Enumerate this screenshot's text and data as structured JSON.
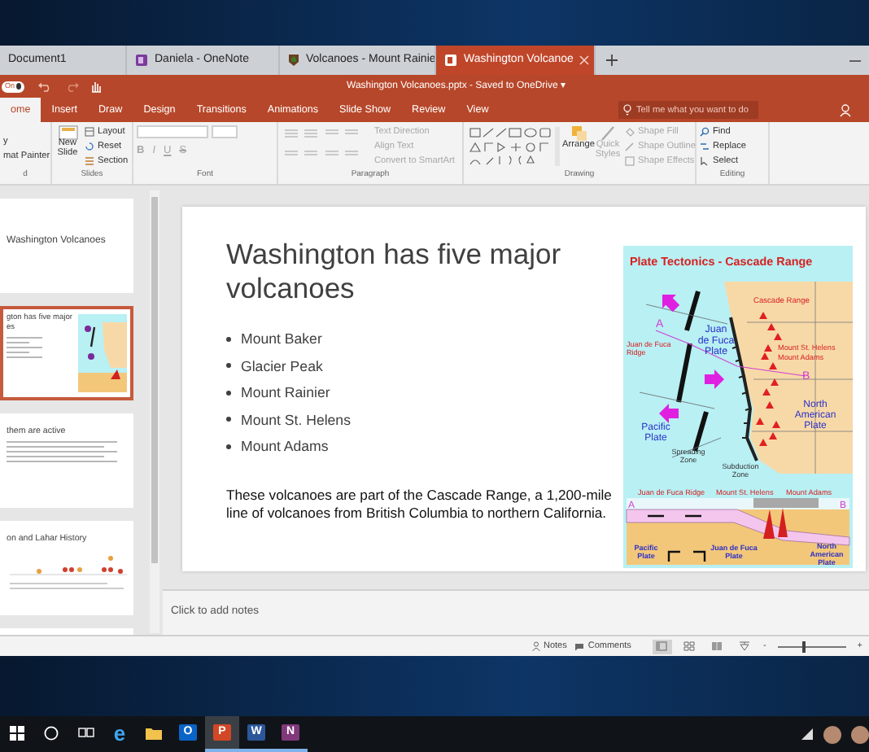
{
  "browser_tabs": [
    {
      "label": "Document1",
      "kind": "plain",
      "selected": false
    },
    {
      "label": "Daniela - OneNote",
      "kind": "notebook",
      "selected": false
    },
    {
      "label": "Volcanoes - Mount Rainie",
      "kind": "shield",
      "selected": false
    },
    {
      "label": "Washington Volcanoe",
      "kind": "slides",
      "selected": true
    }
  ],
  "title_bar": {
    "autosave": "On",
    "autosave_on": true,
    "title": "Washington Volcanoes.pptx - Saved to OneDrive ▾"
  },
  "ribbon_tabs": [
    {
      "label": "ome",
      "selected": true
    },
    {
      "label": "Insert",
      "selected": false
    },
    {
      "label": "Draw",
      "selected": false
    },
    {
      "label": "Design",
      "selected": false
    },
    {
      "label": "Transitions",
      "selected": false
    },
    {
      "label": "Animations",
      "selected": false
    },
    {
      "label": "Slide Show",
      "selected": false
    },
    {
      "label": "Review",
      "selected": false
    },
    {
      "label": "View",
      "selected": false
    }
  ],
  "search": {
    "placeholder": "Tell me what you want to do"
  },
  "ribbon": {
    "clipboard": {
      "commands": [
        "y",
        "mat Painter"
      ],
      "label": "d"
    },
    "slides": {
      "new_slide": "New Slide",
      "commands": [
        "Layout",
        "Reset",
        "Section"
      ],
      "label": "Slides"
    },
    "font": {
      "formatting": [
        {
          "label": "B",
          "disabled": true
        },
        {
          "label": "I",
          "disabled": true
        },
        {
          "label": "U",
          "disabled": true
        },
        {
          "label": "S",
          "disabled": true
        }
      ],
      "label": "Font"
    },
    "paragraph": {
      "commands": [
        {
          "label": "Text Direction",
          "disabled": true
        },
        {
          "label": "Align Text",
          "disabled": true
        },
        {
          "label": "Convert to SmartArt",
          "disabled": true
        }
      ],
      "label": "Paragraph"
    },
    "drawing": {
      "arrange": "Arrange",
      "quick_styles": {
        "label": "Quick Styles",
        "disabled": true
      },
      "commands": [
        {
          "label": "Shape Fill",
          "disabled": true
        },
        {
          "label": "Shape Outline",
          "disabled": true
        },
        {
          "label": "Shape Effects",
          "disabled": true
        }
      ],
      "label": "Drawing"
    },
    "editing": {
      "commands": [
        "Find",
        "Replace",
        "Select"
      ],
      "label": "Editing"
    }
  },
  "thumbnails": [
    {
      "kind": "title",
      "lines": [
        "Washington Volcanoes"
      ],
      "selected": false
    },
    {
      "kind": "map",
      "lines": [
        "gton has five major",
        "es"
      ],
      "selected": true
    },
    {
      "kind": "text",
      "lines": [
        "them are active"
      ],
      "selected": false
    },
    {
      "kind": "chart",
      "lines": [
        "on and Lahar History"
      ],
      "selected": false
    },
    {
      "kind": "blank",
      "selected": false
    }
  ],
  "slide": {
    "title": "Washington has five major volcanoes",
    "bullets": [
      "Mount Baker",
      "Glacier Peak",
      "Mount Rainier",
      "Mount St. Helens",
      "Mount Adams"
    ],
    "paragraph": "These volcanoes are part of the Cascade Range, a 1,200-mile line of volcanoes from British Columbia to northern California.",
    "diagram": {
      "title": "Plate Tectonics - Cascade Range",
      "labels": [
        {
          "kind": "place",
          "lines": [
            "Cascade Range"
          ]
        },
        {
          "kind": "point",
          "lines": [
            "A"
          ]
        },
        {
          "kind": "place",
          "lines": [
            "Juan de Fuca",
            "Ridge"
          ]
        },
        {
          "kind": "plate",
          "lines": [
            "Juan",
            "de Fuca",
            "Plate"
          ]
        },
        {
          "kind": "place",
          "lines": [
            "Mount St. Helens"
          ]
        },
        {
          "kind": "place",
          "lines": [
            "Mount Adams"
          ]
        },
        {
          "kind": "point",
          "lines": [
            "B"
          ]
        },
        {
          "kind": "plate",
          "lines": [
            "North",
            "American",
            "Plate"
          ]
        },
        {
          "kind": "plate",
          "lines": [
            "Pacific",
            "Plate"
          ]
        },
        {
          "kind": "zone",
          "lines": [
            "Spreading",
            "Zone"
          ]
        },
        {
          "kind": "zone",
          "lines": [
            "Subduction",
            "Zone"
          ]
        },
        {
          "kind": "point",
          "lines": [
            "A"
          ]
        },
        {
          "kind": "place",
          "lines": [
            "Juan de Fuca Ridge"
          ]
        },
        {
          "kind": "place",
          "lines": [
            "Mount St. Helens"
          ]
        },
        {
          "kind": "place",
          "lines": [
            "Mount Adams"
          ]
        },
        {
          "kind": "point",
          "lines": [
            "B"
          ]
        },
        {
          "kind": "plate",
          "lines": [
            "Pacific",
            "Plate"
          ]
        },
        {
          "kind": "plate",
          "lines": [
            "Juan de Fuca",
            "Plate"
          ]
        },
        {
          "kind": "plate",
          "lines": [
            "North",
            "American",
            "Plate"
          ]
        }
      ]
    }
  },
  "notes": {
    "placeholder": "Click to add notes"
  },
  "status_bar": {
    "notes": "Notes",
    "comments": "Comments",
    "views": [
      {
        "kind": "normal",
        "selected": true
      },
      {
        "kind": "sorter",
        "selected": false
      },
      {
        "kind": "reading",
        "selected": false
      },
      {
        "kind": "show",
        "selected": false
      }
    ],
    "zoom_out": "-",
    "zoom_in": "+",
    "zoom": {
      "level": 0.38
    }
  },
  "taskbar": [
    {
      "kind": "start",
      "selected": false,
      "running": false
    },
    {
      "kind": "search",
      "selected": false,
      "running": false
    },
    {
      "kind": "taskview",
      "selected": false,
      "running": false
    },
    {
      "kind": "edge",
      "glyph": "e",
      "selected": false,
      "running": false
    },
    {
      "kind": "folder",
      "selected": false,
      "running": false
    },
    {
      "kind": "app",
      "glyph": "O",
      "color": "#0a64c8",
      "selected": false,
      "running": false
    },
    {
      "kind": "app",
      "glyph": "P",
      "color": "#d24726",
      "selected": true,
      "running": true
    },
    {
      "kind": "app",
      "glyph": "W",
      "color": "#2b579a",
      "selected": false,
      "running": true
    },
    {
      "kind": "app",
      "glyph": "N",
      "color": "#80397b",
      "selected": false,
      "running": true
    }
  ],
  "tray": [
    {
      "kind": "network"
    },
    {
      "kind": "avatar"
    },
    {
      "kind": "avatar"
    }
  ]
}
